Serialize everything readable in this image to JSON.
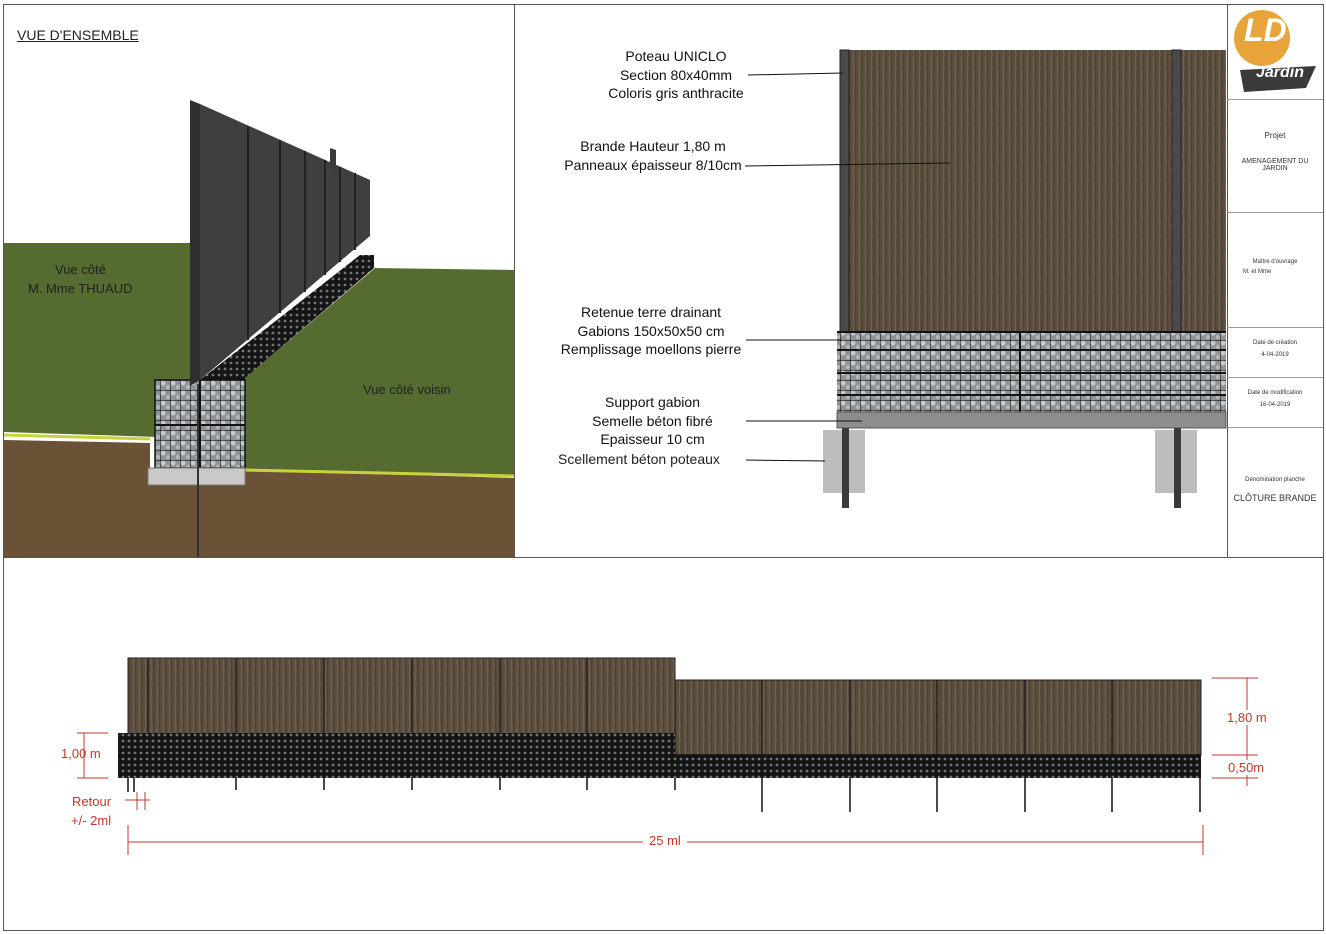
{
  "overview": {
    "title": "VUE D'ENSEMBLE",
    "side_owner": [
      "Vue côté",
      "M. Mme THUAUD"
    ],
    "side_neighbor": "Vue côté voisin"
  },
  "section": {
    "callouts": {
      "post": [
        "Poteau UNICLO",
        "Section 80x40mm",
        "Coloris gris anthracite"
      ],
      "panel": [
        "Brande Hauteur 1,80 m",
        "Panneaux épaisseur 8/10cm"
      ],
      "gabion": [
        "Retenue terre drainant",
        "Gabions 150x50x50 cm",
        "Remplissage moellons pierre"
      ],
      "footing": [
        "Support gabion",
        "Semelle béton fibré",
        "Epaisseur 10 cm"
      ],
      "sealing": "Scellement béton poteaux"
    }
  },
  "title_block": {
    "logo_text": "Jardin",
    "logo_letters": "LD",
    "project_label": "Projet",
    "project_value": [
      "AMENAGEMENT DU",
      "JARDIN"
    ],
    "owner_label": "Maître d'ouvrage",
    "owner_value": "M. et Mme",
    "created_label": "Date de création",
    "created_value": "4-04-2019",
    "modified_label": "Date de modification",
    "modified_value": "16-04-2019",
    "sheet_label": "Dénomination planche",
    "sheet_value": "CLÔTURE BRANDE"
  },
  "elevation": {
    "dim_left": "1,00 m",
    "dim_return": [
      "Retour",
      "+/- 2ml"
    ],
    "dim_length": "25 ml",
    "dim_height": "1,80 m",
    "dim_gabion": "0,50m"
  },
  "colors": {
    "brande": "#5b4d3e",
    "grass": "#556b2f",
    "soil": "#6b5237",
    "post": "#3a3a3a",
    "dimension": "#c0392b"
  }
}
